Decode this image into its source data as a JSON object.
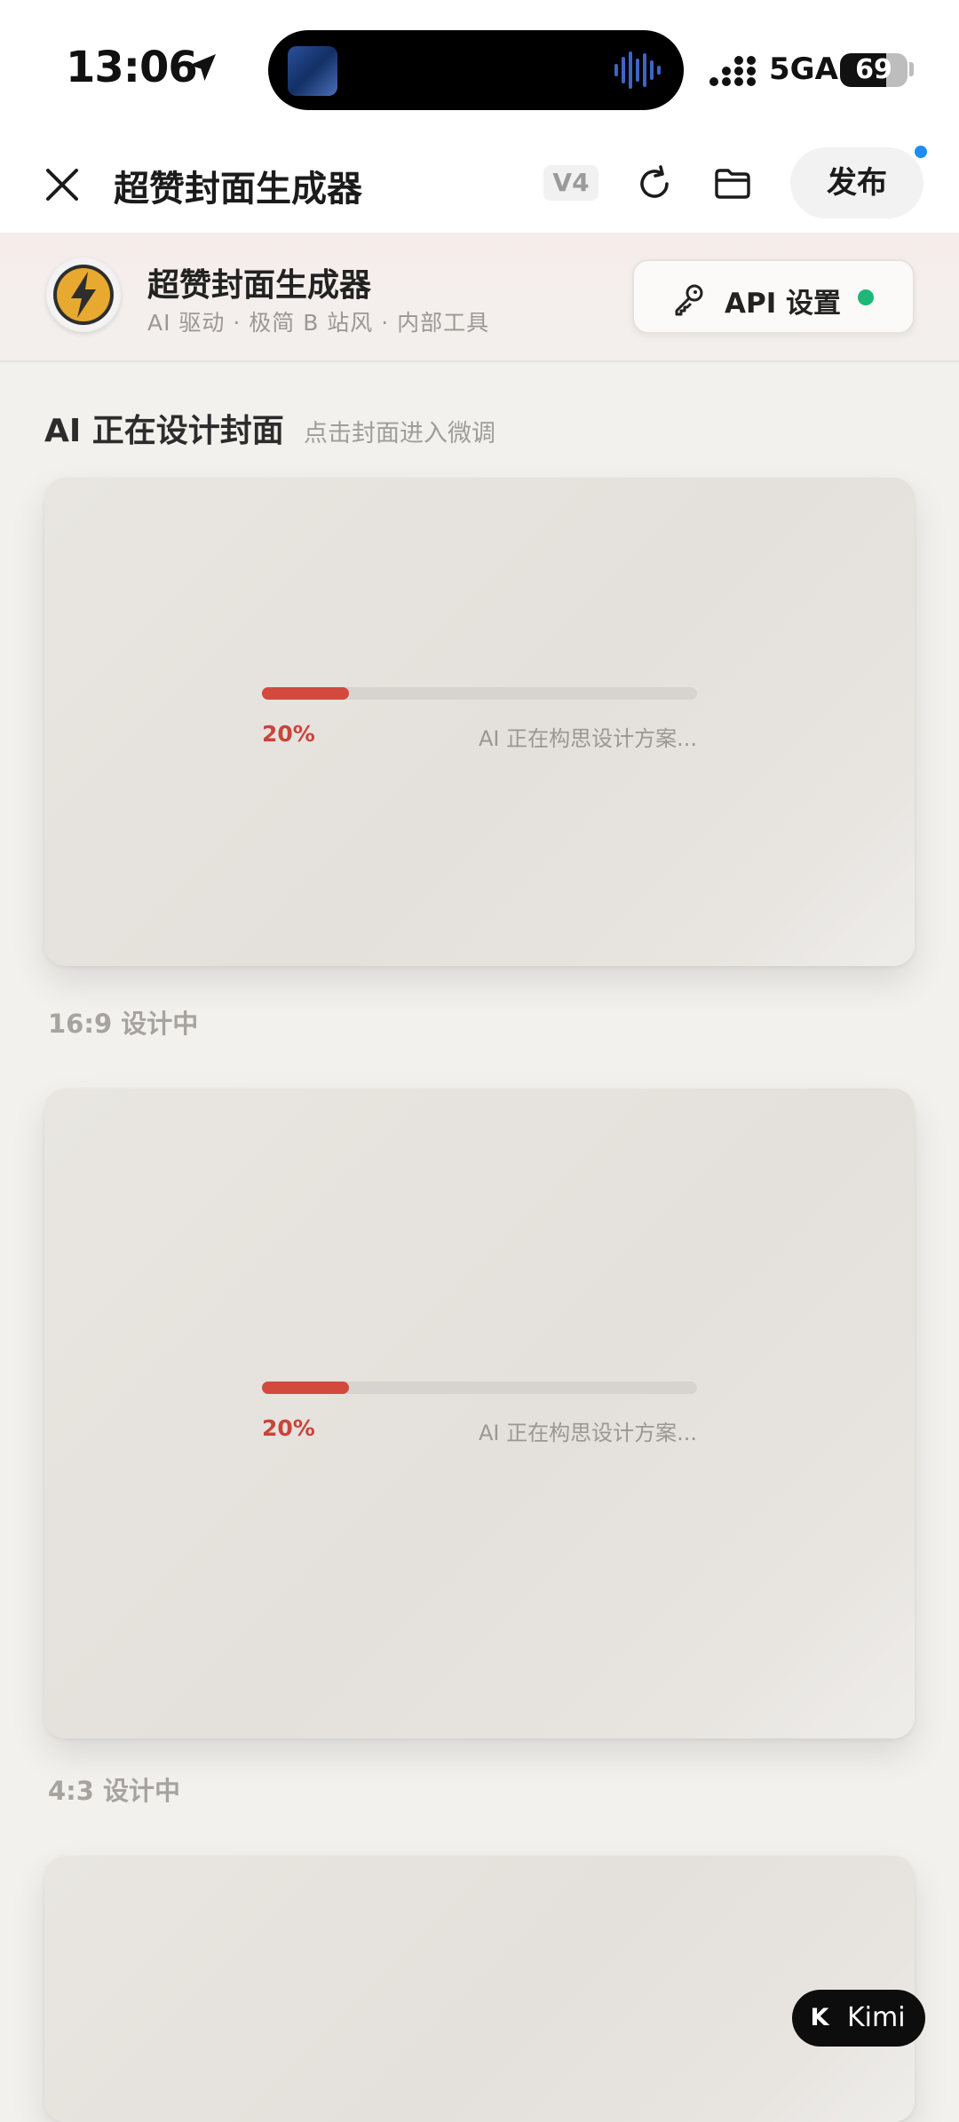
{
  "status_bar": {
    "time": "13:06",
    "network": "5GA",
    "battery": "69",
    "battery_level": 0.69
  },
  "header": {
    "title": "超赞封面生成器",
    "version": "V4",
    "publish_label": "发布"
  },
  "brand": {
    "name": "超赞封面生成器",
    "subtitle": "AI 驱动 · 极简 B 站风 · 内部工具",
    "api_label": "API 设置",
    "api_status_color": "#1db877"
  },
  "section": {
    "title": "AI 正在设计封面",
    "hint": "点击封面进入微调"
  },
  "cards": [
    {
      "progress": 0.2,
      "percent_label": "20%",
      "status": "AI 正在构思设计方案...",
      "caption": "16:9 设计中"
    },
    {
      "progress": 0.2,
      "percent_label": "20%",
      "status": "AI 正在构思设计方案...",
      "caption": "4:3 设计中"
    },
    {
      "progress": null,
      "percent_label": "",
      "status": "",
      "caption": ""
    }
  ],
  "floating": {
    "kimi_label": "Kimi",
    "kimi_logo": "K"
  },
  "colors": {
    "accent": "#d3493e",
    "publish_dot": "#1f8df0"
  }
}
